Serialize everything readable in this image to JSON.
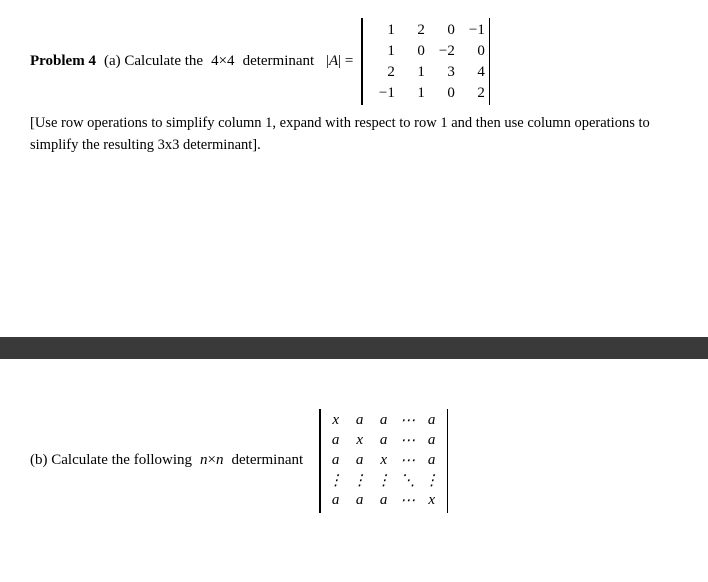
{
  "problem4": {
    "label": "Problem 4",
    "part_a_prefix": "(a) Calculate the",
    "part_a_size": "4×4",
    "part_a_word": "determinant",
    "matrix_var": "|A|=",
    "matrix_4x4": [
      [
        "1",
        "2",
        "0",
        "−1"
      ],
      [
        "1",
        "0",
        "−2",
        "0"
      ],
      [
        "2",
        "1",
        "3",
        "4"
      ],
      [
        "−1",
        "1",
        "0",
        "2"
      ]
    ],
    "instructions": "[Use row operations to simplify column 1, expand with respect to row 1 and then use column operations to simplify the resulting 3x3 determinant].",
    "part_b_prefix": "(b) Calculate the following",
    "part_b_size": "n×n",
    "part_b_word": "determinant",
    "matrix_nxn": [
      [
        "x",
        "a",
        "a",
        "⋯",
        "a"
      ],
      [
        "a",
        "x",
        "a",
        "⋯",
        "a"
      ],
      [
        "a",
        "a",
        "x",
        "⋯",
        "a"
      ],
      [
        "⋮",
        "⋮",
        "⋮",
        "⋱",
        "⋮"
      ],
      [
        "a",
        "a",
        "a",
        "⋯",
        "x"
      ]
    ]
  }
}
